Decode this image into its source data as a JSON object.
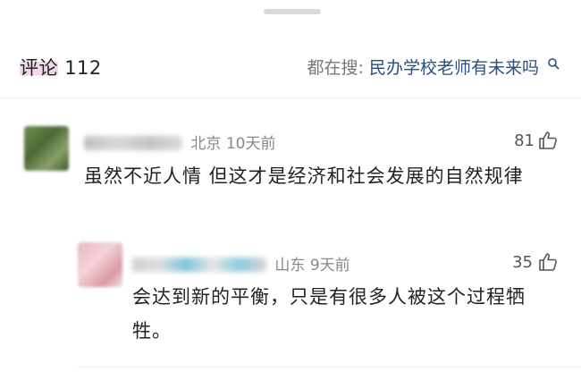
{
  "header": {
    "title_label": "评论",
    "comment_count": "112",
    "hot_search_prefix": "都在搜:",
    "hot_search_term": "民办学校老师有未来吗"
  },
  "comments": [
    {
      "location": "北京",
      "time": "10天前",
      "likes": "81",
      "text": "虽然不近人情 但这才是经济和社会发展的自然规律"
    },
    {
      "location": "山东",
      "time": "9天前",
      "likes": "35",
      "text": "会达到新的平衡，只是有很多人被这个过程牺牲。"
    }
  ],
  "icons": {
    "search": "search-icon",
    "like": "thumbs-up-icon"
  },
  "colors": {
    "link_blue": "#2a4f7f",
    "title_highlight": "#f3d7ea",
    "meta_gray": "#888888"
  }
}
